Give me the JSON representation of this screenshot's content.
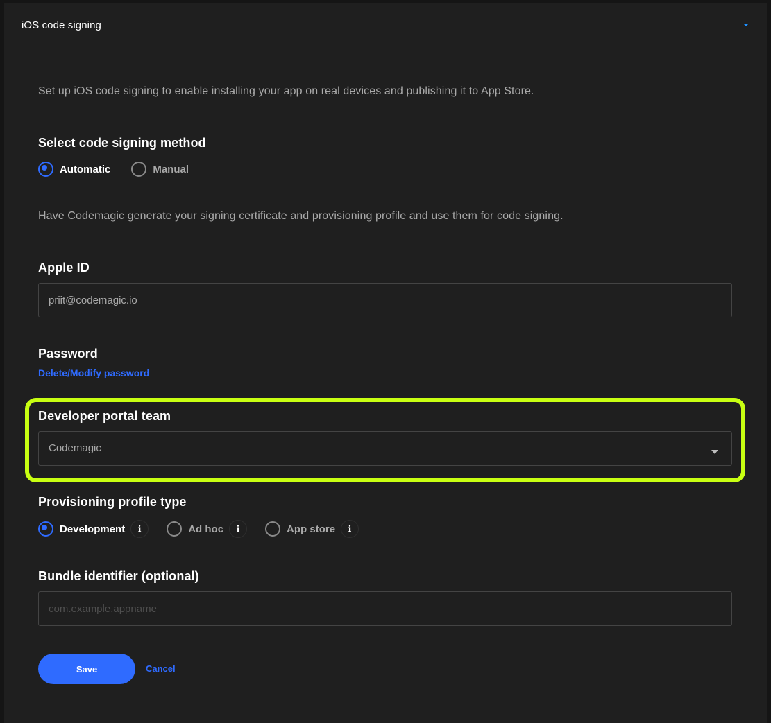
{
  "header": {
    "title": "iOS code signing",
    "toggle_icon": "chevron-down-icon",
    "accent_color": "#1e90ff"
  },
  "intro": {
    "description": "Set up iOS code signing to enable installing your app on real devices and publishing it to App Store."
  },
  "signing_method": {
    "title": "Select code signing method",
    "options": [
      {
        "label": "Automatic",
        "checked": true
      },
      {
        "label": "Manual",
        "checked": false
      }
    ],
    "description": "Have Codemagic generate your signing certificate and provisioning profile and use them for code signing."
  },
  "apple_id": {
    "label": "Apple ID",
    "value": "priit@codemagic.io"
  },
  "password": {
    "label": "Password",
    "link": "Delete/Modify password"
  },
  "developer_team": {
    "label": "Developer portal team",
    "selected": "Codemagic",
    "highlight_color": "#c8ff12"
  },
  "profile_type": {
    "title": "Provisioning profile type",
    "options": [
      {
        "label": "Development",
        "checked": true,
        "info": "i"
      },
      {
        "label": "Ad hoc",
        "checked": false,
        "info": "i"
      },
      {
        "label": "App store",
        "checked": false,
        "info": "i"
      }
    ]
  },
  "bundle_id": {
    "label": "Bundle identifier (optional)",
    "value": "",
    "placeholder": "com.example.appname"
  },
  "actions": {
    "save_label": "Save",
    "cancel_label": "Cancel",
    "primary_color": "#2f6bff"
  }
}
